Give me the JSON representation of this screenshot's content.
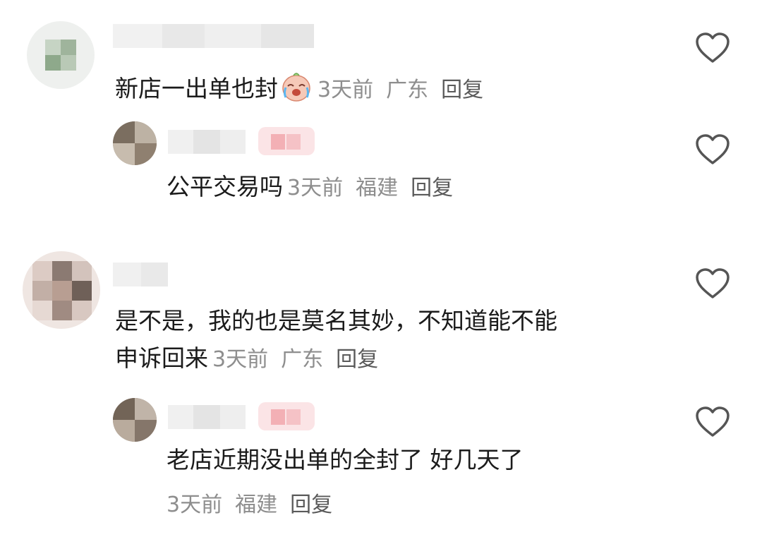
{
  "comments": [
    {
      "text": "新店一出单也封",
      "emoji": "crying-face-emoji",
      "time": "3天前",
      "location": "广东",
      "reply": "回复"
    },
    {
      "text": "公平交易吗",
      "time": "3天前",
      "location": "福建",
      "reply": "回复"
    },
    {
      "text_line1": "是不是，我的也是莫名其妙，不知道能不能",
      "text_line2": "申诉回来",
      "time": "3天前",
      "location": "广东",
      "reply": "回复"
    },
    {
      "text": "老店近期没出单的全封了 好几天了",
      "time": "3天前",
      "location": "福建",
      "reply": "回复"
    }
  ],
  "icons": {
    "like": "heart-outline-icon"
  },
  "colors": {
    "text": "#1b1b1b",
    "meta": "#8e8e8e",
    "reply": "#5a5a5a",
    "heart_stroke": "#555555"
  }
}
